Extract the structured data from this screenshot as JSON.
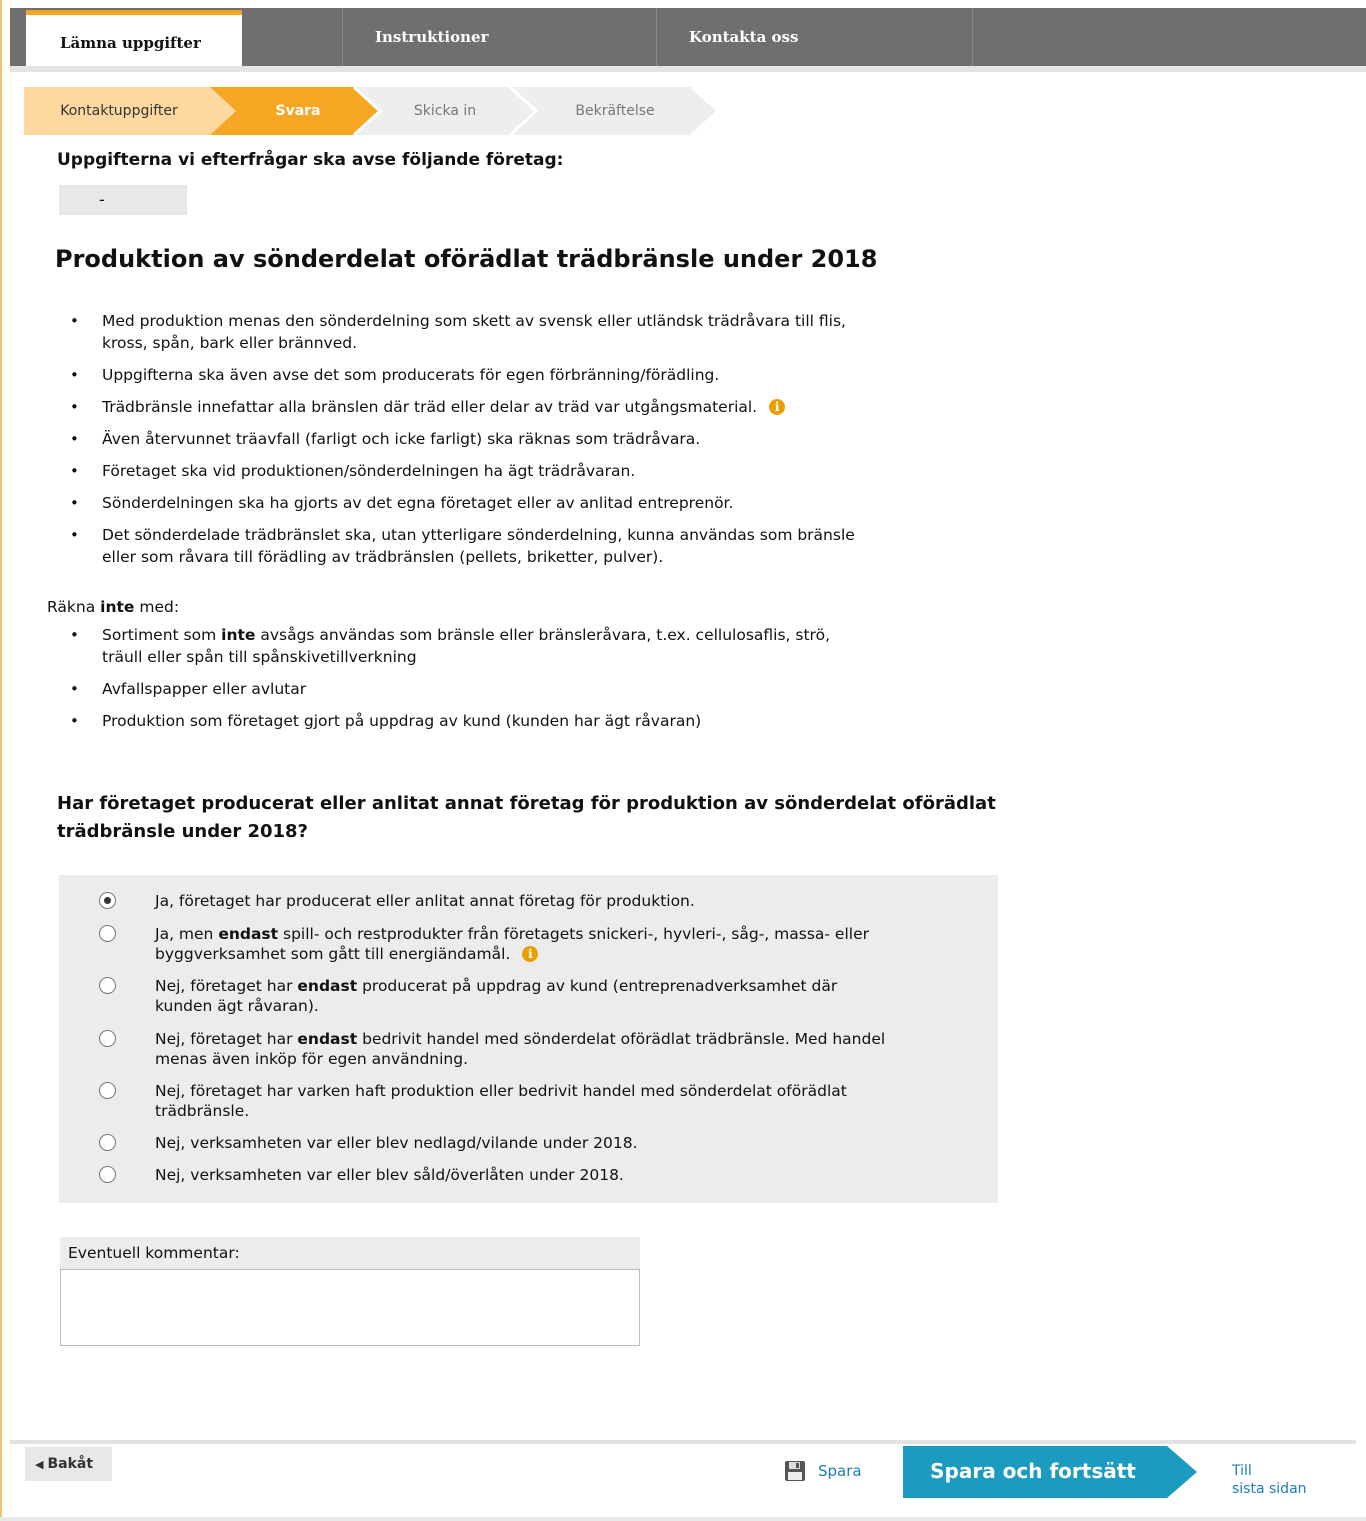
{
  "nav": {
    "tabs": [
      {
        "label": "Lämna uppgifter",
        "active": true
      },
      {
        "label": "Instruktioner",
        "active": false
      },
      {
        "label": "Kontakta oss",
        "active": false
      }
    ],
    "accent": "#f5a623"
  },
  "steps": [
    {
      "label": "Kontaktuppgifter",
      "state": "done"
    },
    {
      "label": "Svara",
      "state": "current"
    },
    {
      "label": "Skicka in",
      "state": "todo"
    },
    {
      "label": "Bekräftelse",
      "state": "todo"
    }
  ],
  "company": {
    "label": "Uppgifterna vi efterfrågar ska avse följande företag:",
    "value": "-"
  },
  "main": {
    "title": "Produktion av sönderdelat oförädlat trädbränsle under 2018",
    "bullets": [
      "Med produktion menas den sönderdelning som skett av svensk eller utländsk trädråvara till flis,\nkross, spån, bark eller brännved.",
      "Uppgifterna ska även avse det som producerats för egen förbränning/förädling.",
      "Trädbränsle innefattar alla bränslen där träd eller delar av träd var utgångsmaterial.",
      "Även återvunnet träavfall (farligt och icke farligt) ska räknas som trädråvara.",
      "Företaget ska vid produktionen/sönderdelningen ha ägt trädråvaran.",
      "Sönderdelningen ska ha gjorts av det egna företaget eller av anlitad entreprenör.",
      "Det sönderdelade trädbränslet ska, utan ytterligare sönderdelning, kunna användas som bränsle\neller som råvara till förädling av trädbränslen (pellets, briketter, pulver)."
    ],
    "exclude": {
      "lead_before": "Räkna ",
      "lead_bold": "inte",
      "lead_after": " med:",
      "bullet1_before": "Sortiment som ",
      "bullet1_bold": "inte",
      "bullet1_after": " avsågs användas som bränsle eller bränsleråvara, t.ex. cellulosaflis, strö,\nträull eller spån till spånskivetillverkning",
      "bullet2": "Avfallspapper eller avlutar",
      "bullet3": "Produktion som företaget gjort på uppdrag av kund (kunden har ägt råvaran)"
    }
  },
  "question": {
    "text": "Har företaget producerat eller anlitat annat företag för produktion av sönderdelat oförädlat trädbränsle under 2018?",
    "selected_index": 0,
    "options": [
      {
        "before": "Ja, företaget har producerat eller anlitat annat företag för produktion.",
        "bold": "",
        "after": ""
      },
      {
        "before": "Ja, men ",
        "bold": "endast",
        "after": " spill- och restprodukter från företagets snickeri-, hyvleri-, såg-, massa- eller\nbyggverksamhet som gått till energiändamål."
      },
      {
        "before": "Nej, företaget har ",
        "bold": "endast",
        "after": " producerat på uppdrag av kund (entreprenadverksamhet där\nkunden ägt råvaran)."
      },
      {
        "before": "Nej, företaget har ",
        "bold": "endast",
        "after": " bedrivit handel med sönderdelat oförädlat trädbränsle. Med handel\nmenas även inköp för egen användning."
      },
      {
        "before": "Nej, företaget har varken haft produktion eller bedrivit handel med sönderdelat oförädlat\nträdbränsle.",
        "bold": "",
        "after": ""
      },
      {
        "before": "Nej, verksamheten var eller blev nedlagd/vilande under 2018.",
        "bold": "",
        "after": ""
      },
      {
        "before": "Nej, verksamheten var eller blev såld/överlåten under 2018.",
        "bold": "",
        "after": ""
      }
    ]
  },
  "comment": {
    "label": "Eventuell kommentar:",
    "value": ""
  },
  "footer": {
    "back": "Bakåt",
    "save": "Spara",
    "save_continue": "Spara och fortsätt",
    "last_page_line1": "Till",
    "last_page_line2": "sista sidan",
    "primary_color": "#1a9bbf"
  }
}
